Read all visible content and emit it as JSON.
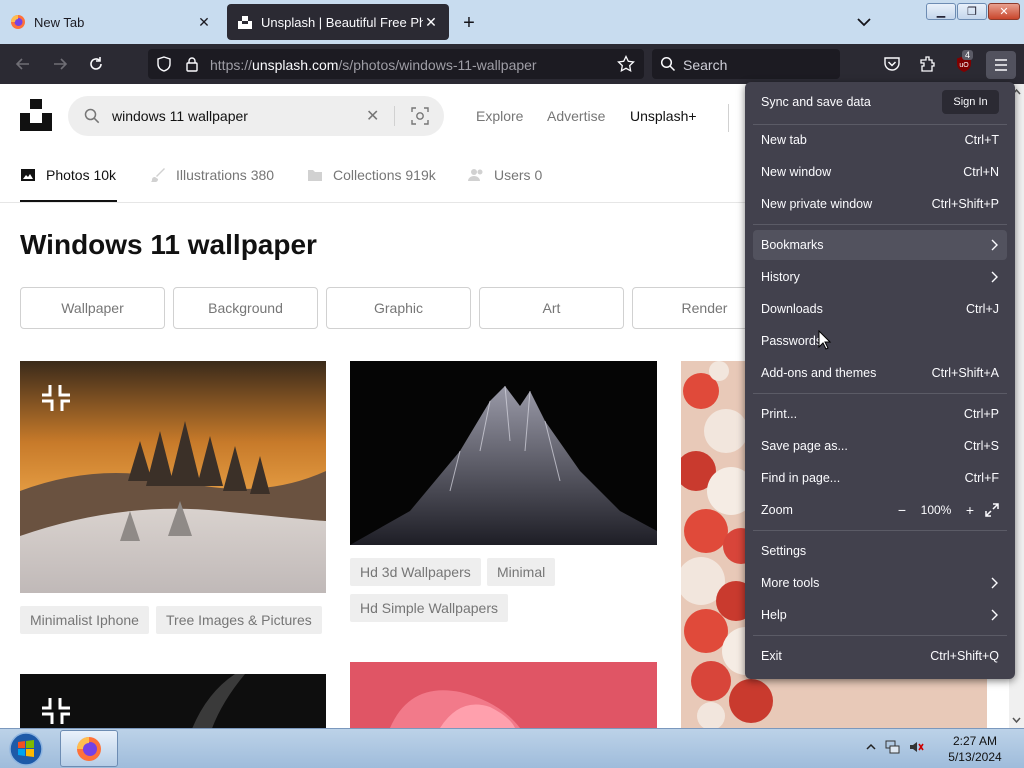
{
  "browser": {
    "tabs": [
      {
        "title": "New Tab",
        "active": false
      },
      {
        "title": "Unsplash | Beautiful Free Photos",
        "active": true
      }
    ],
    "url": {
      "prefix": "https://",
      "domain": "unsplash.com",
      "path": "/s/photos/windows-11-wallpaper"
    },
    "search_placeholder": "Search",
    "extension_badge": "4"
  },
  "page": {
    "search_query": "windows 11 wallpaper",
    "nav_links": [
      "Explore",
      "Advertise",
      "Unsplash+"
    ],
    "tabs": [
      {
        "label": "Photos 10k",
        "icon": "photo-icon"
      },
      {
        "label": "Illustrations 380",
        "icon": "brush-icon"
      },
      {
        "label": "Collections 919k",
        "icon": "folder-icon"
      },
      {
        "label": "Users 0",
        "icon": "users-icon"
      }
    ],
    "heading": "Windows 11 wallpaper",
    "chips": [
      "Wallpaper",
      "Background",
      "Graphic",
      "Art",
      "Render"
    ],
    "photo1_tags": [
      "Minimalist Iphone",
      "Tree Images & Pictures"
    ],
    "photo2_tags": [
      "Hd 3d Wallpapers",
      "Minimal",
      "Hd Simple Wallpapers"
    ]
  },
  "menu": {
    "sync_label": "Sync and save data",
    "signin_label": "Sign In",
    "items": [
      {
        "label": "New tab",
        "shortcut": "Ctrl+T"
      },
      {
        "label": "New window",
        "shortcut": "Ctrl+N"
      },
      {
        "label": "New private window",
        "shortcut": "Ctrl+Shift+P"
      },
      {
        "label": "Bookmarks",
        "shortcut": ""
      },
      {
        "label": "History",
        "shortcut": ""
      },
      {
        "label": "Downloads",
        "shortcut": "Ctrl+J"
      },
      {
        "label": "Passwords",
        "shortcut": ""
      },
      {
        "label": "Add-ons and themes",
        "shortcut": "Ctrl+Shift+A"
      },
      {
        "label": "Print...",
        "shortcut": "Ctrl+P"
      },
      {
        "label": "Save page as...",
        "shortcut": "Ctrl+S"
      },
      {
        "label": "Find in page...",
        "shortcut": "Ctrl+F"
      },
      {
        "label": "Zoom",
        "shortcut": ""
      },
      {
        "label": "Settings",
        "shortcut": ""
      },
      {
        "label": "More tools",
        "shortcut": ""
      },
      {
        "label": "Help",
        "shortcut": ""
      },
      {
        "label": "Exit",
        "shortcut": "Ctrl+Shift+Q"
      }
    ],
    "zoom": {
      "minus": "−",
      "value": "100%",
      "plus": "+"
    }
  },
  "taskbar": {
    "time": "2:27 AM",
    "date": "5/13/2024"
  },
  "colors": {
    "menu_bg": "#42414d",
    "toolbar_bg": "#2b2a33",
    "tabstrip_bg": "#c8dcef"
  }
}
